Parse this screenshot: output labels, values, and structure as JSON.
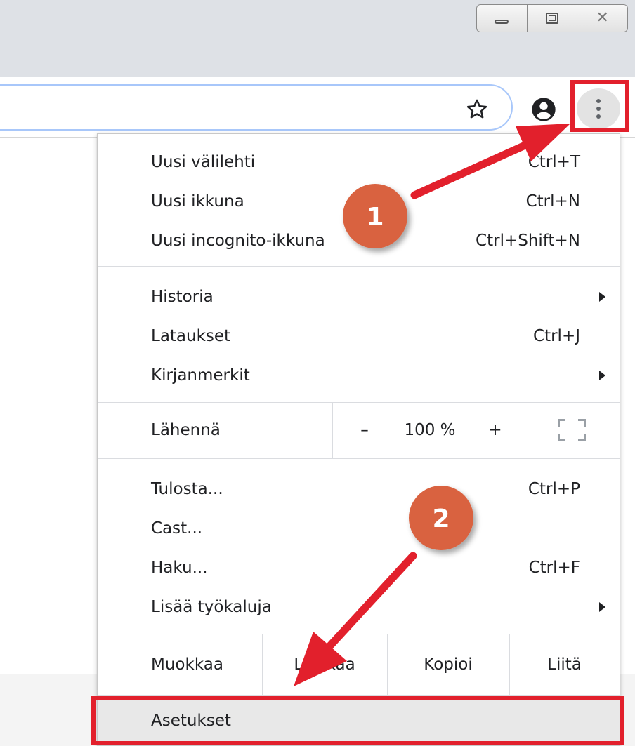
{
  "window_controls": {
    "minimize_icon": "minimize-icon",
    "maximize_icon": "maximize-icon",
    "close_icon": "close-icon"
  },
  "toolbar": {
    "bookmark_icon": "star-icon",
    "profile_icon": "account-circle-icon",
    "menu_icon": "more-vert-icon"
  },
  "menu": {
    "new_tab": {
      "label": "Uusi välilehti",
      "shortcut": "Ctrl+T"
    },
    "new_window": {
      "label": "Uusi ikkuna",
      "shortcut": "Ctrl+N"
    },
    "new_incognito": {
      "label": "Uusi incognito-ikkuna",
      "shortcut": "Ctrl+Shift+N"
    },
    "history": {
      "label": "Historia"
    },
    "downloads": {
      "label": "Lataukset",
      "shortcut": "Ctrl+J"
    },
    "bookmarks": {
      "label": "Kirjanmerkit"
    },
    "zoom": {
      "label": "Lähennä",
      "minus": "–",
      "value": "100 %",
      "plus": "+"
    },
    "print": {
      "label": "Tulosta...",
      "shortcut": "Ctrl+P"
    },
    "cast": {
      "label": "Cast..."
    },
    "find": {
      "label": "Haku...",
      "shortcut": "Ctrl+F"
    },
    "more_tools": {
      "label": "Lisää työkaluja"
    },
    "edit": {
      "label": "Muokkaa",
      "cut": "Leikkaa",
      "copy": "Kopioi",
      "paste": "Liitä"
    },
    "settings": {
      "label": "Asetukset"
    }
  },
  "annotations": {
    "step1": "1",
    "step2": "2",
    "highlight_color": "#e2202c",
    "arrow_color": "#e2202c",
    "badge_color": "#d9623f"
  }
}
